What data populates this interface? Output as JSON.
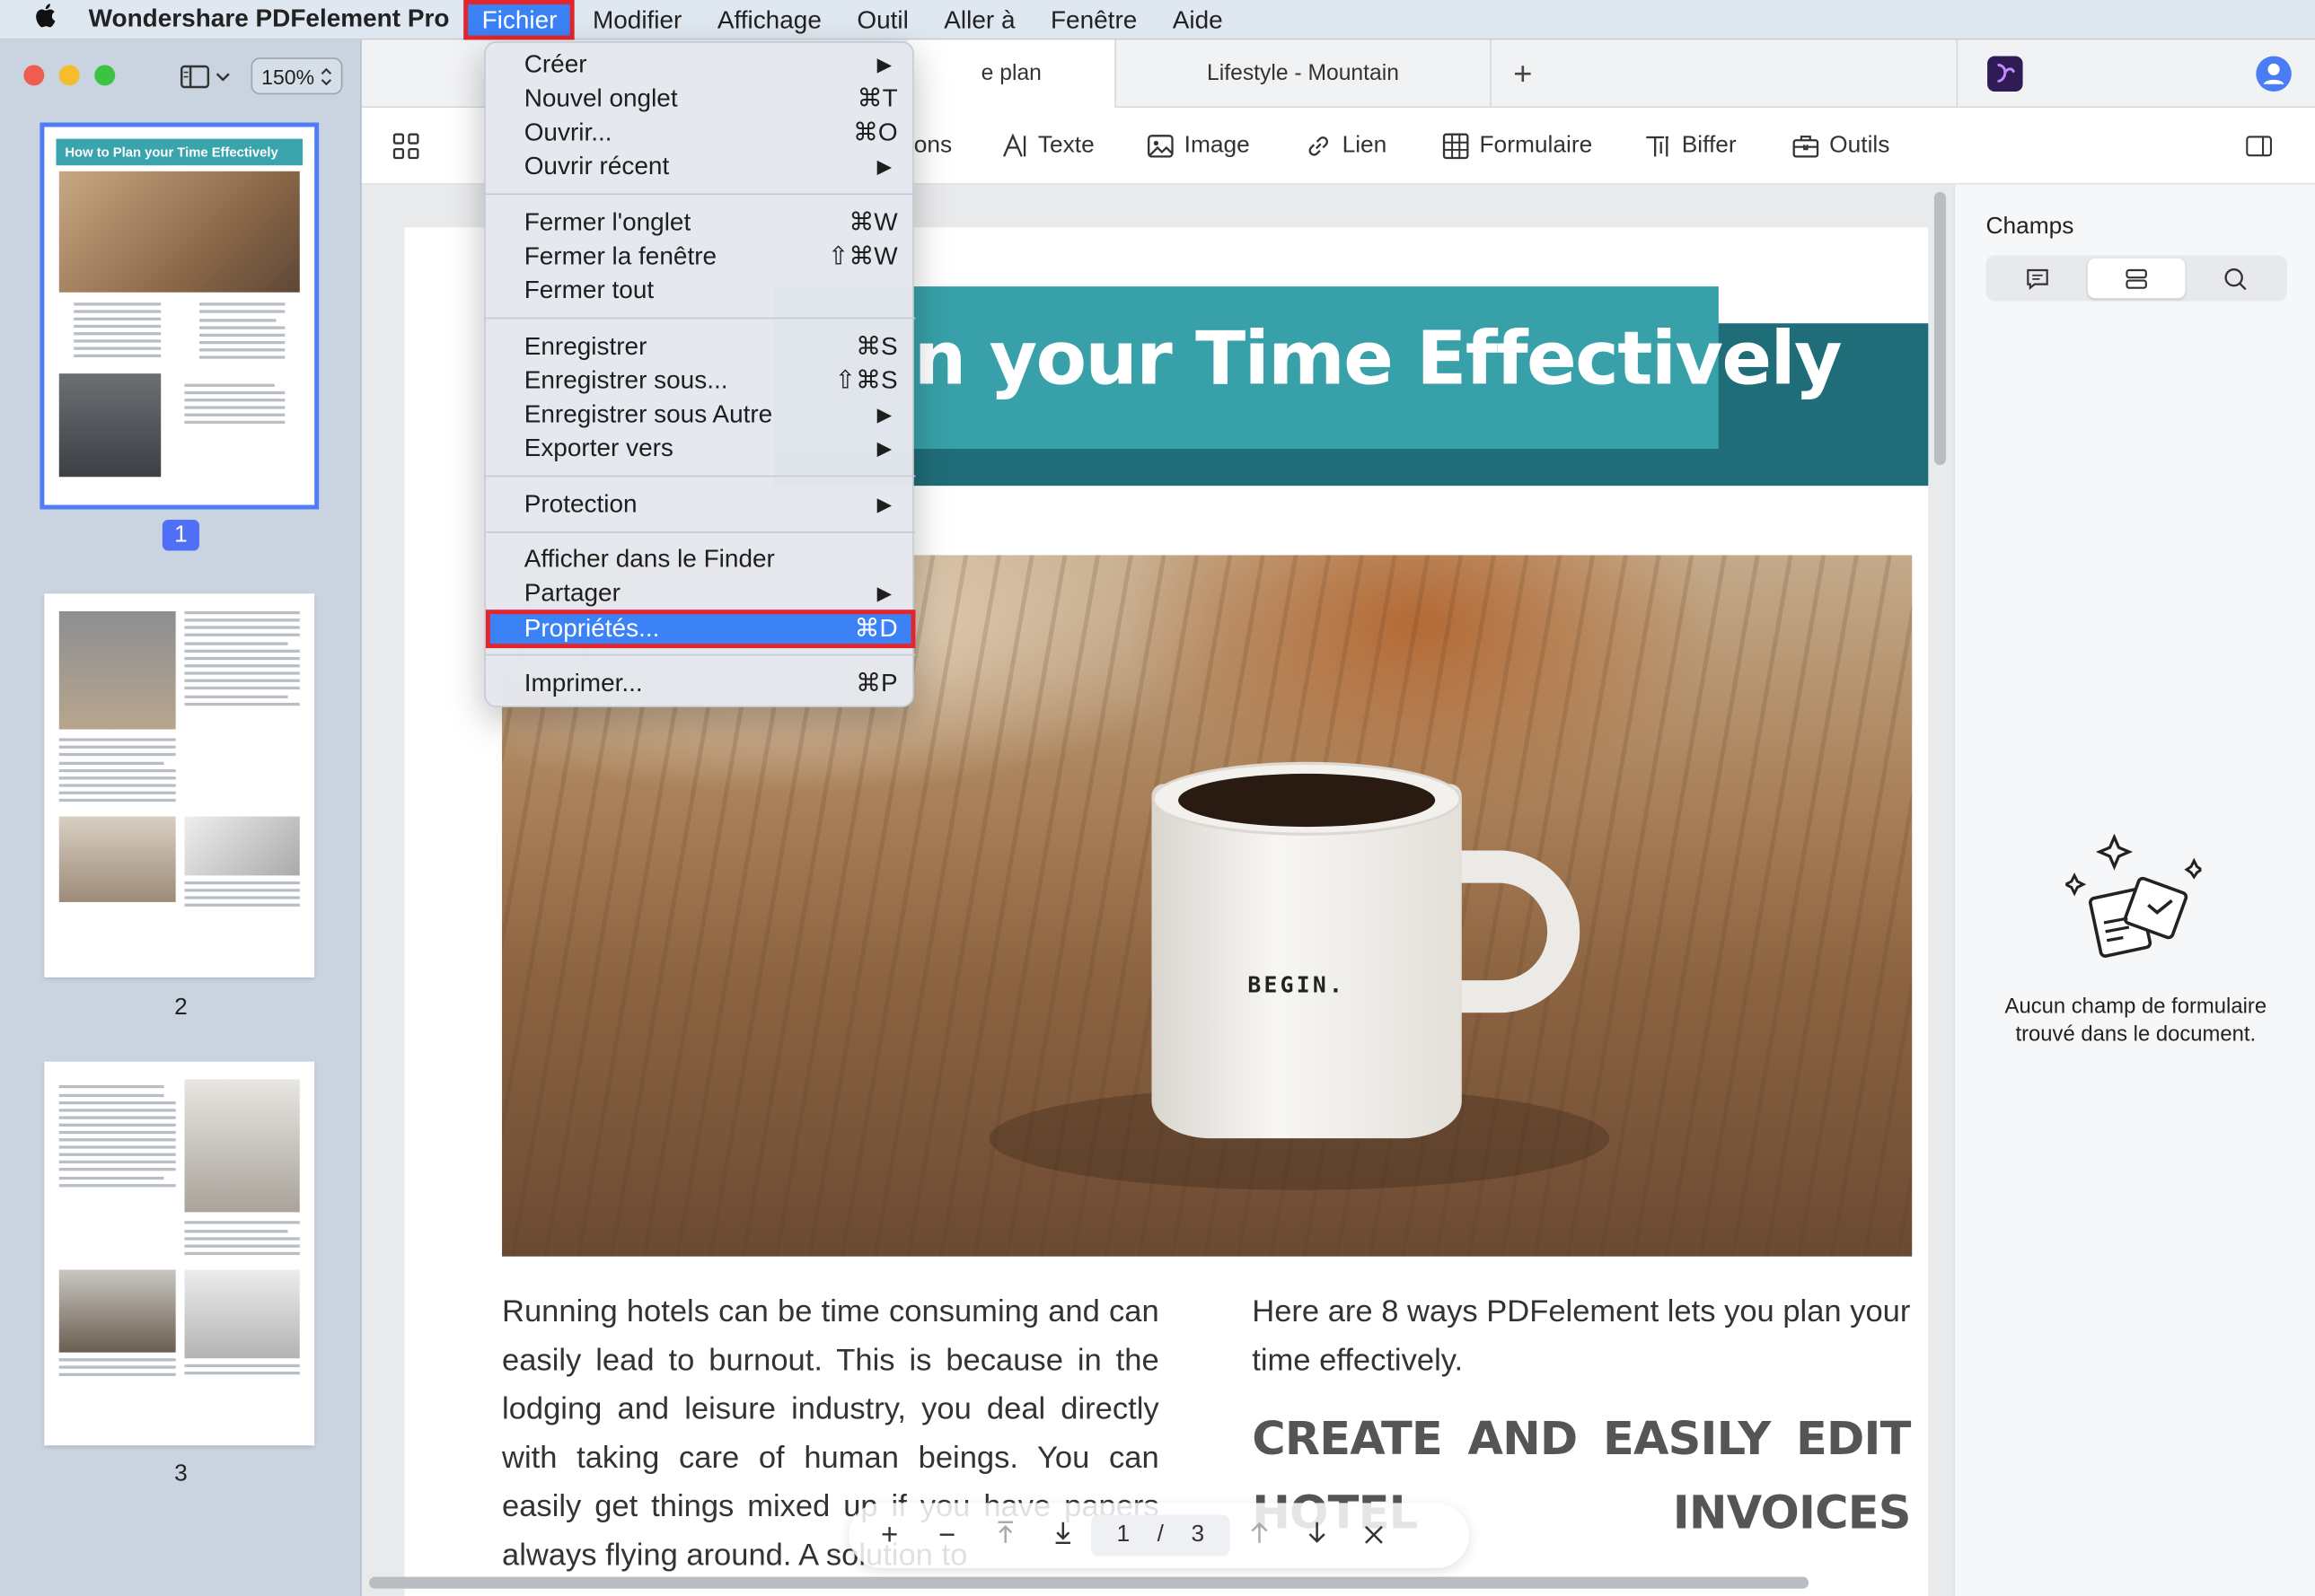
{
  "menubar": {
    "app_name": "Wondershare PDFelement Pro",
    "items": [
      "Fichier",
      "Modifier",
      "Affichage",
      "Outil",
      "Aller à",
      "Fenêtre",
      "Aide"
    ]
  },
  "sidebar": {
    "zoom": "150%",
    "thumbs": [
      {
        "label": "1",
        "title": "How to Plan your Time Effectively"
      },
      {
        "label": "2"
      },
      {
        "label": "3"
      }
    ]
  },
  "tabs": {
    "current": "e plan",
    "other": "Lifestyle - Mountain",
    "add": "+"
  },
  "toolbar": {
    "items": [
      "ons",
      "Texte",
      "Image",
      "Lien",
      "Formulaire",
      "Biffer",
      "Outils"
    ]
  },
  "document": {
    "banner": "n your Time Effectively",
    "mug_text": "BEGIN.",
    "left_text": "Running hotels can be time consuming and can easily lead to burnout. This is because in the lodging and leisure industry, you deal directly with taking care of human beings. You can easily get things mixed up if you have papers always flying around. A solution to",
    "right_text": "Here are 8 ways PDFelement lets you plan your time effectively.",
    "right_heading": "CREATE AND EASILY EDIT HOTEL INVOICES"
  },
  "page_control": {
    "current": "1",
    "separator": "/",
    "total": "3"
  },
  "right_panel": {
    "title": "Champs",
    "empty_message": "Aucun champ de formulaire trouvé dans le document."
  },
  "file_menu": {
    "items": [
      {
        "label": "Créer",
        "shortcut": "",
        "submenu": true
      },
      {
        "label": "Nouvel onglet",
        "shortcut": "⌘T"
      },
      {
        "label": "Ouvrir...",
        "shortcut": "⌘O"
      },
      {
        "label": "Ouvrir récent",
        "shortcut": "",
        "submenu": true
      },
      {
        "label": "Fermer l'onglet",
        "shortcut": "⌘W"
      },
      {
        "label": "Fermer la fenêtre",
        "shortcut": "⇧⌘W"
      },
      {
        "label": "Fermer tout",
        "shortcut": ""
      },
      {
        "label": "Enregistrer",
        "shortcut": "⌘S"
      },
      {
        "label": "Enregistrer sous...",
        "shortcut": "⇧⌘S"
      },
      {
        "label": "Enregistrer sous Autre",
        "shortcut": "",
        "submenu": true
      },
      {
        "label": "Exporter vers",
        "shortcut": "",
        "submenu": true
      },
      {
        "label": "Protection",
        "shortcut": "",
        "submenu": true
      },
      {
        "label": "Afficher dans le Finder",
        "shortcut": ""
      },
      {
        "label": "Partager",
        "shortcut": "",
        "submenu": true
      },
      {
        "label": "Propriétés...",
        "shortcut": "⌘D",
        "highlighted": true
      },
      {
        "label": "Imprimer...",
        "shortcut": "⌘P"
      }
    ],
    "submenu_arrow": "▶"
  },
  "colors": {
    "accent": "#3b82f6",
    "highlight_border": "#e3262b",
    "banner_teal": "#38a0a8",
    "banner_dark_teal": "#1f6d78"
  }
}
